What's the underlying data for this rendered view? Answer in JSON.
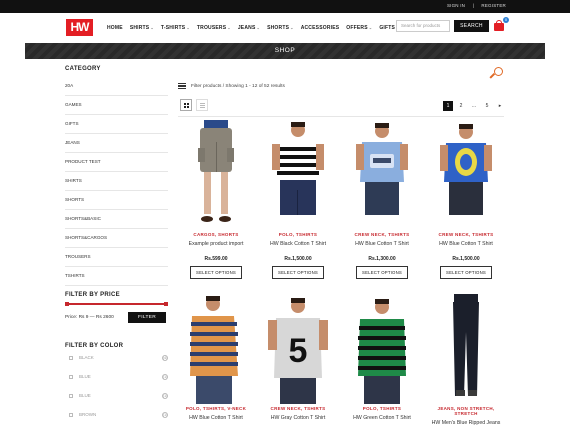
{
  "topbar": {
    "signin": "SIGN IN",
    "separator": "|",
    "register": "REGISTER"
  },
  "logo": {
    "text": "HW"
  },
  "nav": [
    {
      "label": "HOME",
      "dropdown": false
    },
    {
      "label": "SHIRTS",
      "dropdown": true
    },
    {
      "label": "T-SHIRTS",
      "dropdown": true
    },
    {
      "label": "TROUSERS",
      "dropdown": true
    },
    {
      "label": "JEANS",
      "dropdown": true
    },
    {
      "label": "SHORTS",
      "dropdown": true
    },
    {
      "label": "ACCESSORIES",
      "dropdown": false
    },
    {
      "label": "OFFERS",
      "dropdown": true
    },
    {
      "label": "GIFTS",
      "dropdown": true
    }
  ],
  "search": {
    "placeholder": "Search for products",
    "button": "SEARCH"
  },
  "cart": {
    "count": "0"
  },
  "banner": {
    "title": "SHOP"
  },
  "sidebar": {
    "category_title": "CATEGORY",
    "categories": [
      "20A",
      "GAMES",
      "GIFTS",
      "JEANS",
      "PRODUCT TEST",
      "SHIRTS",
      "SHORTS",
      "SHORTS&BASIC",
      "SHORTS&CARGOS",
      "TROUSERS",
      "TSHIRTS"
    ],
    "price_title": "FILTER BY PRICE",
    "price_label": "Price: Rs 9 — Rs 2600",
    "filter_button": "FILTER",
    "color_title": "FILTER BY COLOR",
    "colors": [
      {
        "name": "BLACK",
        "count": "(4)"
      },
      {
        "name": "BLUE",
        "count": "(1)"
      },
      {
        "name": "BLUE",
        "count": "(1)"
      },
      {
        "name": "BROWN",
        "count": "(1)"
      }
    ]
  },
  "toolbar": {
    "results": "Filter products / Showing 1 - 12 of 52 results"
  },
  "pagination": [
    "1",
    "2",
    "...",
    "5",
    "▸"
  ],
  "colors": {
    "accent": "#c6272d",
    "brand": "#e31e24",
    "dark": "#111111"
  },
  "products": [
    {
      "category": "CARGOS, SHORTS",
      "name": "Example product import",
      "price": "Rs.599.00",
      "button": "SELECT OPTIONS"
    },
    {
      "category": "POLO, TSHIRTS",
      "name": "HW Black Cotton T Shirt",
      "price": "Rs.1,500.00",
      "button": "SELECT OPTIONS"
    },
    {
      "category": "CREW NECK, TSHIRTS",
      "name": "HW Blue Cotton T Shirt",
      "price": "Rs.1,300.00",
      "button": "SELECT OPTIONS"
    },
    {
      "category": "CREW NECK, TSHIRTS",
      "name": "HW Blue Cotton T Shirt",
      "price": "Rs.1,500.00",
      "button": "SELECT OPTIONS"
    },
    {
      "category": "POLO, TSHIRTS, V-NECK",
      "name": "HW Blue Cotton T Shirt",
      "price": "",
      "button": ""
    },
    {
      "category": "CREW NECK, TSHIRTS",
      "name": "HW Gray Cotton T Shirt",
      "price": "",
      "button": ""
    },
    {
      "category": "POLO, TSHIRTS",
      "name": "HW Green Cotton T Shirt",
      "price": "",
      "button": ""
    },
    {
      "category": "JEANS, NON STRETCH, STRETCH",
      "name": "HW Men's Blue Ripped Jeans",
      "price": "",
      "button": ""
    }
  ]
}
